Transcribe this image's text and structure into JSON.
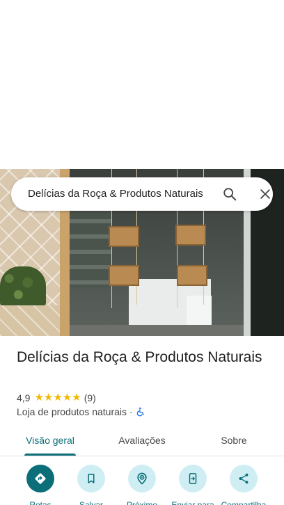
{
  "search": {
    "value": "Delícias da Roça & Produtos Naturais"
  },
  "place": {
    "name": "Delícias da Roça & Produtos Naturais",
    "rating": "4,9",
    "stars": "★★★★★",
    "review_count": "(9)",
    "category": "Loja de produtos naturais",
    "separator": "·",
    "accessibility_icon": "wheelchair-icon"
  },
  "tabs": [
    {
      "label": "Visão geral",
      "active": true
    },
    {
      "label": "Avaliações",
      "active": false
    },
    {
      "label": "Sobre",
      "active": false
    }
  ],
  "actions": [
    {
      "label": "Rotas",
      "icon": "directions-icon"
    },
    {
      "label": "Salvar",
      "icon": "bookmark-icon"
    },
    {
      "label": "Próximo",
      "icon": "nearby-icon"
    },
    {
      "label": "Enviar para",
      "icon": "send-to-phone-icon"
    },
    {
      "label": "Compartilha",
      "icon": "share-icon"
    }
  ],
  "colors": {
    "accent": "#0b6e78",
    "action_bg": "#cfeef3",
    "star": "#f3b700",
    "accessibility": "#1a73e8"
  }
}
